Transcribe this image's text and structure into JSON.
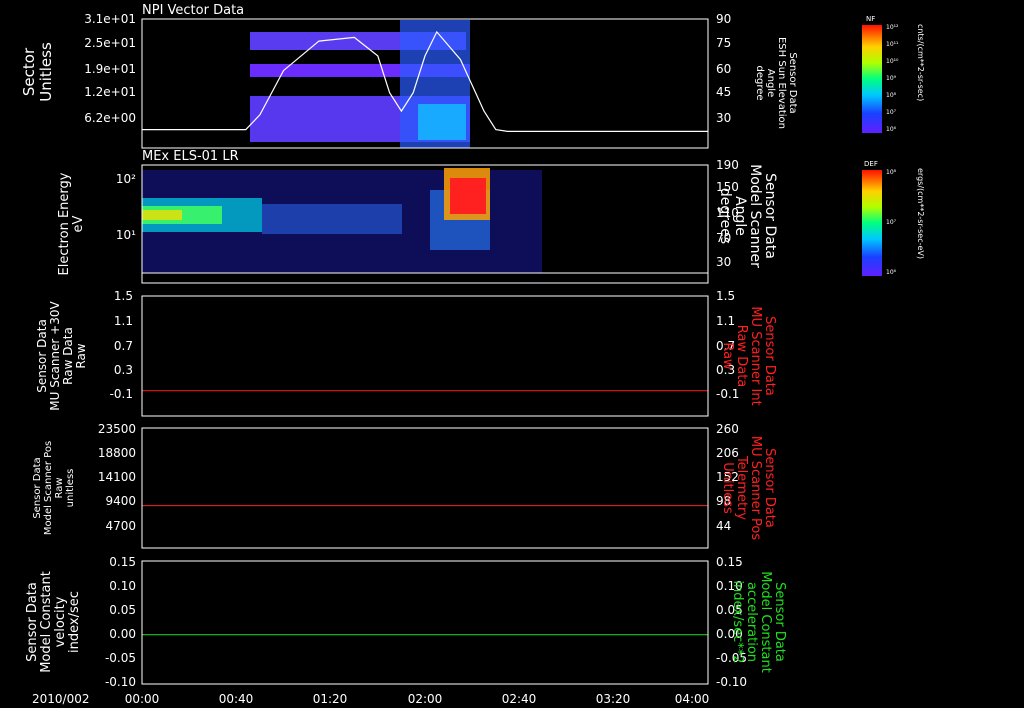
{
  "date_label": "2010/002",
  "x_ticks": [
    "00:00",
    "00:40",
    "01:20",
    "02:00",
    "02:40",
    "03:20",
    "04:00"
  ],
  "chart_data": [
    {
      "type": "heatmap",
      "title": "NPI Vector Data",
      "ylabel": [
        "Sector",
        "Unitless"
      ],
      "y_ticks": [
        "3.1e+01",
        "2.5e+01",
        "1.9e+01",
        "1.2e+01",
        "6.2e+00"
      ],
      "ylabel_right": [
        "Sensor Data",
        "ESH Sun Elevation",
        "Angle",
        "degree"
      ],
      "y_ticks_right": [
        "90",
        "75",
        "60",
        "45",
        "30"
      ],
      "xlim_minutes": [
        0,
        240
      ],
      "ylim_right": [
        20,
        90
      ],
      "line_series": {
        "name": "ESH Sun Elevation Angle",
        "x_minutes": [
          0,
          44,
          50,
          60,
          75,
          90,
          100,
          105,
          110,
          115,
          120,
          125,
          135,
          145,
          150,
          155,
          240
        ],
        "values": [
          30,
          30,
          38,
          62,
          78,
          80,
          70,
          50,
          40,
          50,
          70,
          83,
          68,
          40,
          30,
          29,
          29
        ]
      },
      "colorbar": {
        "label": "NF",
        "units": "cnts/(cm**2-sr-sec)",
        "scale": "log",
        "ticks": [
          "10¹²",
          "10¹¹",
          "10¹⁰",
          "10⁹",
          "10⁸",
          "10⁷",
          "10⁶"
        ]
      },
      "data_x_range_minutes": [
        45,
        142
      ]
    },
    {
      "type": "heatmap",
      "title": "MEx ELS-01 LR",
      "ylabel": [
        "Electron Energy",
        "eV"
      ],
      "y_ticks": [
        "10²",
        "10¹"
      ],
      "yscale": "log",
      "ylabel_right": [
        "Sensor Data",
        "Model Scanner",
        "Angle",
        "degrees"
      ],
      "y_ticks_right": [
        "190",
        "150",
        "110",
        "70",
        "30"
      ],
      "colorbar": {
        "label": "DEF",
        "units": "ergs/(cm**2-sr-sec-eV)",
        "scale": "log",
        "ticks": [
          "10⁸",
          "10⁷",
          "10⁶"
        ]
      },
      "data_x_range_minutes": [
        0,
        167
      ]
    },
    {
      "type": "line",
      "ylabel": [
        "Sensor Data",
        "MU Scanner +30V",
        "Raw Data",
        "Raw"
      ],
      "y_ticks": [
        "1.5",
        "1.1",
        "0.7",
        "0.3",
        "-0.1"
      ],
      "ylim": [
        -0.4,
        1.5
      ],
      "ylabel_right": [
        "Sensor Data",
        "MU Scanner Int",
        "Raw Data",
        "Raw"
      ],
      "y_ticks_right": [
        "1.5",
        "1.1",
        "0.7",
        "0.3",
        "-0.1"
      ],
      "series": [
        {
          "name": "MU Scanner Int",
          "x_minutes": [
            0,
            240
          ],
          "values": [
            0,
            0
          ],
          "color": "#ff2020"
        }
      ]
    },
    {
      "type": "line",
      "ylabel": [
        "Sensor Data",
        "Model Scanner Pos",
        "Raw",
        "unitless"
      ],
      "y_ticks": [
        "23500",
        "18800",
        "14100",
        "9400",
        "4700"
      ],
      "ylim": [
        0,
        23500
      ],
      "ylabel_right": [
        "Sensor Data",
        "MU Scanner Pos",
        "Telemetry",
        "Unitless"
      ],
      "y_ticks_right": [
        "260",
        "206",
        "152",
        "98",
        "44"
      ],
      "series": [
        {
          "name": "MU Scanner Pos",
          "x_minutes": [
            0,
            240
          ],
          "values": [
            8300,
            8300
          ],
          "color": "#ff2020"
        }
      ]
    },
    {
      "type": "line",
      "ylabel": [
        "Sensor Data",
        "Model Constant",
        "velocity",
        "index/sec"
      ],
      "y_ticks": [
        "0.15",
        "0.10",
        "0.05",
        "0.00",
        "-0.05",
        "-0.10"
      ],
      "ylim": [
        -0.1,
        0.15
      ],
      "ylabel_right": [
        "Sensor Data",
        "Model Constant",
        "acceleration",
        "index/sec**2"
      ],
      "y_ticks_right": [
        "0.15",
        "0.10",
        "0.05",
        "0.00",
        "-0.05",
        "-0.10"
      ],
      "series": [
        {
          "name": "Model Constant acceleration",
          "x_minutes": [
            0,
            240
          ],
          "values": [
            0,
            0
          ],
          "color": "#20e020"
        }
      ]
    }
  ],
  "colors": {
    "axis": "#ffffff",
    "background": "#000000",
    "red_label": "#ff2020",
    "green_label": "#20e020"
  }
}
